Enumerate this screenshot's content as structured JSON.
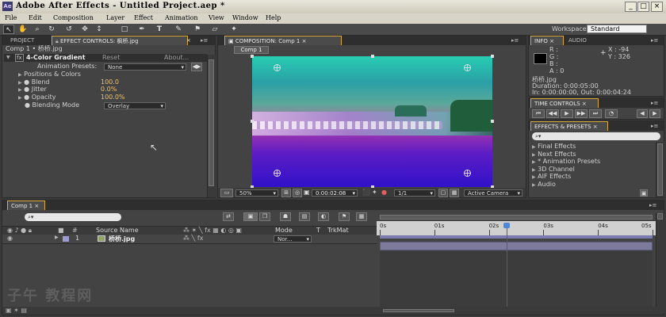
{
  "app": {
    "title": "Adobe After Effects - Untitled Project.aep *",
    "icon": "Ae",
    "window_buttons": [
      "_",
      "□",
      "×"
    ]
  },
  "menu": [
    "File",
    "Edit",
    "Composition",
    "Layer",
    "Effect",
    "Animation",
    "View",
    "Window",
    "Help"
  ],
  "toolbar": {
    "workspace_label": "Workspace:",
    "workspace_value": "Standard",
    "tools": [
      "selection-tool",
      "hand-tool",
      "zoom-tool",
      "rotate-tool",
      "orbit-camera-tool",
      "pan-tool",
      "rectangle-tool",
      "pen-tool",
      "type-tool",
      "brush-tool",
      "clone-stamp-tool",
      "eraser-tool",
      "puppet-pin-tool"
    ]
  },
  "effect_controls": {
    "tab_project": "PROJECT",
    "tab_effect": "EFFECT CONTROLS: 枫桥.jpg",
    "breadcrumb": "Comp 1 • 桥桥.jpg",
    "effect_name": "4-Color Gradient",
    "reset": "Reset",
    "about": "About...",
    "presets_label": "Animation Presets:",
    "presets_value": "None",
    "props": [
      {
        "label": "Positions & Colors",
        "value": ""
      },
      {
        "label": "Blend",
        "value": "100.0"
      },
      {
        "label": "Jitter",
        "value": "0.0%"
      },
      {
        "label": "Opacity",
        "value": "100.0%"
      },
      {
        "label": "Blending Mode",
        "value": "Overlay"
      }
    ]
  },
  "composition": {
    "tab": "COMPOSITION: Comp 1",
    "subtab": "Comp 1",
    "zoom": "50%",
    "timecode": "0:00:02:08",
    "resolution": "1/1",
    "camera": "Active Camera"
  },
  "info": {
    "tab_info": "INFO",
    "tab_audio": "AUDIO",
    "channels": [
      "R :",
      "G :",
      "B :",
      "A : 0"
    ],
    "x": "X : -94",
    "y": "Y : 326",
    "file": "桥桥.jpg",
    "duration": "Duration: 0:00:05:00",
    "inout": "In: 0:00:00:00, Out: 0:00:04:24"
  },
  "time_controls": {
    "tab": "TIME CONTROLS",
    "buttons": [
      "⏮",
      "◀◀",
      "▶",
      "▶▶",
      "⏭",
      "◔",
      "◀",
      "▶"
    ]
  },
  "effects_presets": {
    "tab": "EFFECTS & PRESETS",
    "search_placeholder": "",
    "items": [
      "Final Effects",
      "Next Effects",
      "* Animation Presets",
      "3D Channel",
      "AIF Effects",
      "Audio"
    ]
  },
  "timeline": {
    "tab": "Comp 1",
    "columns": [
      "Source Name",
      "Mode",
      "T",
      "TrkMat"
    ],
    "ruler": [
      "0s",
      "01s",
      "02s",
      "03s",
      "04s",
      "05s"
    ],
    "playhead_seconds": 2.33,
    "duration_seconds": 5,
    "layer": {
      "index": "1",
      "name": "桥桥.jpg",
      "mode": "Nor..."
    }
  },
  "colors": {
    "accent": "#d9a93b",
    "playhead": "#d42a2a",
    "timeline_bar": "#7c7b9c"
  },
  "watermark": "子午 教程网"
}
